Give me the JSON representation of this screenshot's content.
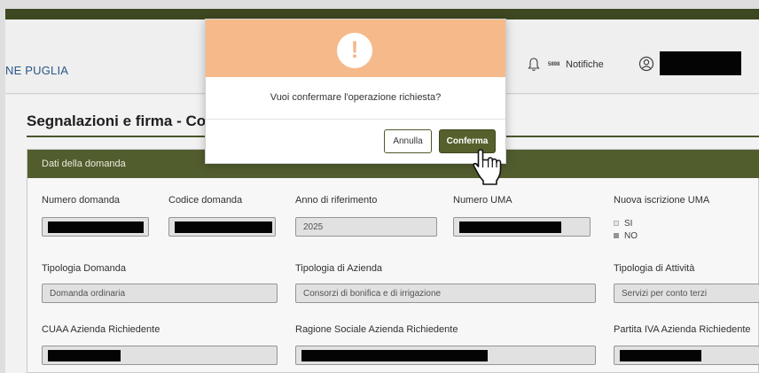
{
  "header": {
    "brand": "NE PUGLIA",
    "notification_count": "5898",
    "notifications_label": "Notifiche"
  },
  "page": {
    "title": "Segnalazioni e firma - Compil"
  },
  "panel": {
    "title": "Dati della domanda",
    "fields": {
      "numero_domanda": {
        "label": "Numero domanda"
      },
      "codice_domanda": {
        "label": "Codice domanda"
      },
      "anno_riferimento": {
        "label": "Anno di riferimento",
        "value": "2025"
      },
      "numero_uma": {
        "label": "Numero UMA"
      },
      "nuova_iscrizione": {
        "label": "Nuova iscrizione UMA",
        "options": [
          "SI",
          "NO"
        ],
        "selected": "NO"
      },
      "tipologia_domanda": {
        "label": "Tipologia Domanda",
        "value": "Domanda ordinaria"
      },
      "tipologia_azienda": {
        "label": "Tipologia di Azienda",
        "value": "Consorzi di bonifica e di irrigazione"
      },
      "tipologia_attivita": {
        "label": "Tipologia di Attività",
        "value": "Servizi per conto terzi"
      },
      "cuaa": {
        "label": "CUAA Azienda Richiedente"
      },
      "ragione_sociale": {
        "label": "Ragione Sociale Azienda Richiedente"
      },
      "partita_iva": {
        "label": "Partita IVA Azienda Richiedente"
      }
    }
  },
  "modal": {
    "icon": "exclamation-icon",
    "icon_symbol": "!",
    "message": "Vuoi confermare l'operazione richiesta?",
    "cancel_label": "Annulla",
    "confirm_label": "Conferma"
  },
  "colors": {
    "topbar": "#3f4a22",
    "panel_header": "#556130",
    "modal_header": "#f6b98a",
    "confirm_button": "#55602c",
    "brand_text": "#2a5a8a"
  }
}
